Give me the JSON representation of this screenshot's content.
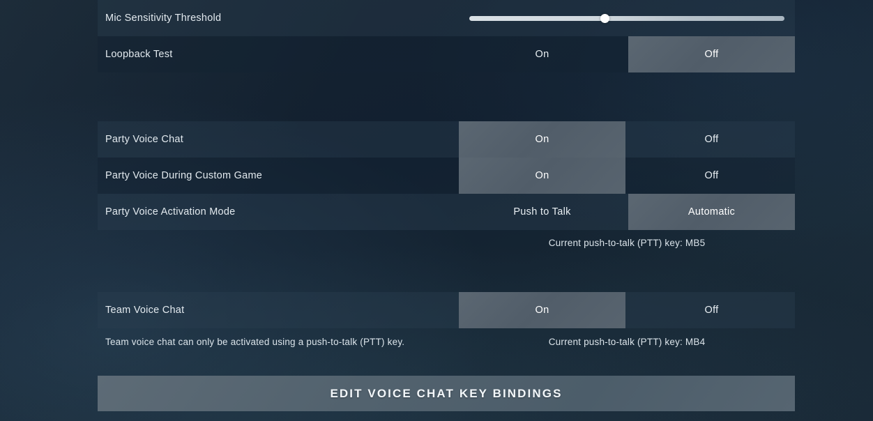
{
  "colors": {
    "background": "#16212e",
    "row_odd": "#2b3e50",
    "row_even": "#142332",
    "selected": "#56626d",
    "text": "#e3eaef",
    "slider_track": "#e8eef2",
    "slider_knob": "#ffffff"
  },
  "settings_groups": [
    {
      "name": "microphone",
      "rows": [
        {
          "label": "Mic Sensitivity Threshold",
          "control": "slider",
          "slider": {
            "value_percent": 43,
            "min": 0,
            "max": 100
          }
        },
        {
          "label": "Loopback Test",
          "control": "toggle",
          "options": [
            "On",
            "Off"
          ],
          "selected": "Off"
        }
      ]
    },
    {
      "name": "party_voice",
      "rows": [
        {
          "label": "Party Voice Chat",
          "control": "toggle",
          "options": [
            "On",
            "Off"
          ],
          "selected": "On"
        },
        {
          "label": "Party Voice During Custom Game",
          "control": "toggle",
          "options": [
            "On",
            "Off"
          ],
          "selected": "On"
        },
        {
          "label": "Party Voice Activation Mode",
          "control": "toggle",
          "options": [
            "Push to Talk",
            "Automatic"
          ],
          "selected": "Automatic"
        }
      ],
      "caption": "Current push-to-talk (PTT) key: MB5"
    },
    {
      "name": "team_voice",
      "rows": [
        {
          "label": "Team Voice Chat",
          "control": "toggle",
          "options": [
            "On",
            "Off"
          ],
          "selected": "On"
        }
      ],
      "note": "Team voice chat can only be activated using a push-to-talk (PTT) key.",
      "caption": "Current push-to-talk (PTT) key: MB4"
    }
  ],
  "footer": {
    "edit_bindings_label": "EDIT VOICE CHAT KEY BINDINGS"
  }
}
